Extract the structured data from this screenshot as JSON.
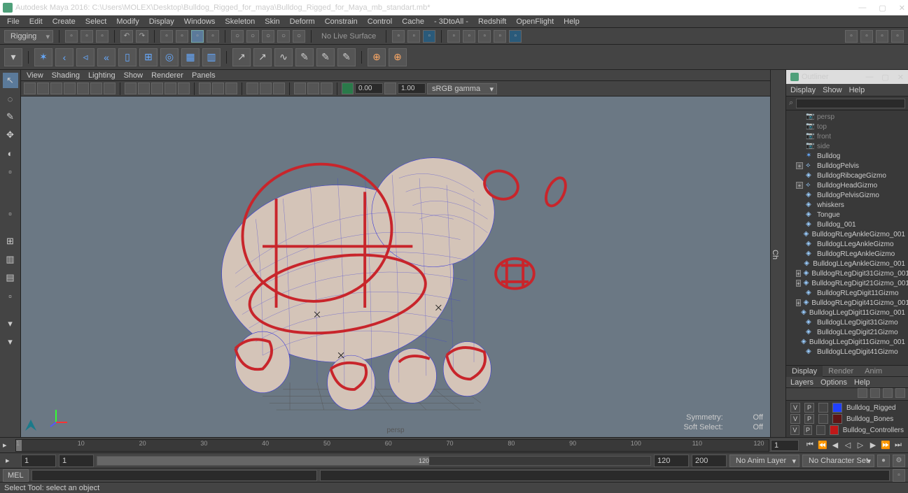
{
  "title": "Autodesk Maya 2016: C:\\Users\\MOLEX\\Desktop\\Bulldog_Rigged_for_maya\\Bulldog_Rigged_for_Maya_mb_standart.mb*",
  "menus": [
    "File",
    "Edit",
    "Create",
    "Select",
    "Modify",
    "Display",
    "Windows",
    "Skeleton",
    "Skin",
    "Deform",
    "Constrain",
    "Control",
    "Cache",
    "- 3DtoAll -",
    "Redshift",
    "OpenFlight",
    "Help"
  ],
  "mode_selector": "Rigging",
  "no_live_surface": "No Live Surface",
  "panel_menus": [
    "View",
    "Shading",
    "Lighting",
    "Show",
    "Renderer",
    "Panels"
  ],
  "exposure": "0.00",
  "gamma": "1.00",
  "color_mgmt": "sRGB gamma",
  "symmetry_lbl": "Symmetry:",
  "symmetry_val": "Off",
  "softsel_lbl": "Soft Select:",
  "softsel_val": "Off",
  "persp": "persp",
  "outliner": {
    "title": "Outliner",
    "menus": [
      "Display",
      "Show",
      "Help"
    ],
    "cams": [
      "persp",
      "top",
      "front",
      "side"
    ],
    "root": "Bulldog",
    "items": [
      {
        "exp": true,
        "name": "BulldogPelvis",
        "kind": "curve"
      },
      {
        "exp": false,
        "name": "BulldogRibcageGizmo",
        "kind": "gizmo"
      },
      {
        "exp": true,
        "name": "BulldogHeadGizmo",
        "kind": "curve"
      },
      {
        "exp": false,
        "name": "BulldogPelvisGizmo",
        "kind": "gizmo"
      },
      {
        "exp": false,
        "name": "whiskers",
        "kind": "gizmo"
      },
      {
        "exp": false,
        "name": "Tongue",
        "kind": "gizmo"
      },
      {
        "exp": false,
        "name": "Bulldog_001",
        "kind": "gizmo"
      },
      {
        "exp": false,
        "name": "BulldogRLegAnkleGizmo_001",
        "kind": "gizmo"
      },
      {
        "exp": false,
        "name": "BulldogLLegAnkleGizmo",
        "kind": "gizmo"
      },
      {
        "exp": false,
        "name": "BulldogRLegAnkleGizmo",
        "kind": "gizmo"
      },
      {
        "exp": false,
        "name": "BulldogLLegAnkleGizmo_001",
        "kind": "gizmo"
      },
      {
        "exp": true,
        "name": "BulldogRLegDigit31Gizmo_001",
        "kind": "gizmo"
      },
      {
        "exp": true,
        "name": "BulldogRLegDigit21Gizmo_001",
        "kind": "gizmo"
      },
      {
        "exp": false,
        "name": "BulldogRLegDigit11Gizmo",
        "kind": "gizmo"
      },
      {
        "exp": true,
        "name": "BulldogRLegDigit41Gizmo_001",
        "kind": "gizmo"
      },
      {
        "exp": false,
        "name": "BulldogLLegDigit11Gizmo_001",
        "kind": "gizmo"
      },
      {
        "exp": false,
        "name": "BulldogLLegDigit31Gizmo",
        "kind": "gizmo"
      },
      {
        "exp": false,
        "name": "BulldogLLegDigit21Gizmo",
        "kind": "gizmo"
      },
      {
        "exp": false,
        "name": "BulldogLLegDigit11Gizmo_001",
        "kind": "gizmo"
      },
      {
        "exp": false,
        "name": "BulldogLLegDigit41Gizmo",
        "kind": "gizmo"
      }
    ]
  },
  "layer_tabs": [
    "Display",
    "Render",
    "Anim"
  ],
  "layer_menus": [
    "Layers",
    "Options",
    "Help"
  ],
  "layers": [
    {
      "v": "V",
      "p": "P",
      "color": "#2040ff",
      "name": "Bulldog_Rigged"
    },
    {
      "v": "V",
      "p": "P",
      "color": "#601515",
      "name": "Bulldog_Bones"
    },
    {
      "v": "V",
      "p": "P",
      "color": "#c01818",
      "name": "Bulldog_Controllers"
    }
  ],
  "time_ticks": [
    1,
    10,
    20,
    30,
    40,
    50,
    60,
    70,
    80,
    90,
    100,
    110,
    120
  ],
  "time_current": "1",
  "range_start": "1",
  "range_inner_start": "1",
  "range_inner_end": "120",
  "range_end1": "120",
  "range_end2": "200",
  "anim_layer": "No Anim Layer",
  "char_set": "No Character Set",
  "cmd_lang": "MEL",
  "help_text": "Select Tool: select an object",
  "ch_label": "Ch"
}
